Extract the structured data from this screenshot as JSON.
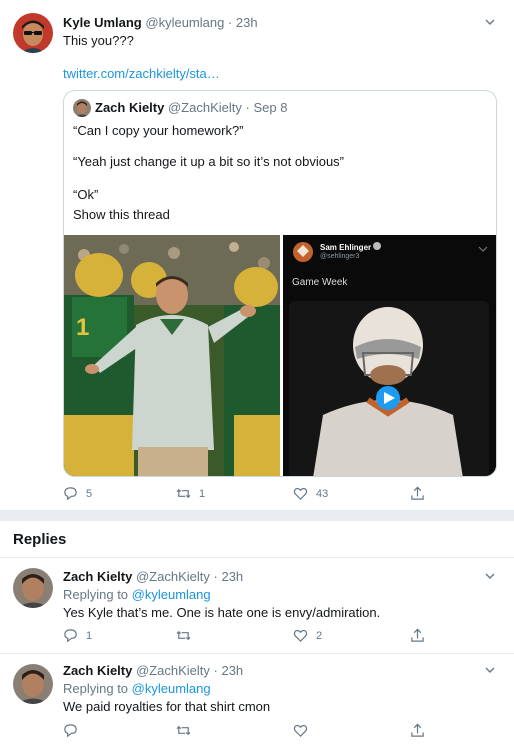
{
  "main_tweet": {
    "name": "Kyle Umlang",
    "handle": "@kyleumlang",
    "dot": "·",
    "time": "23h",
    "text": "This you???",
    "link": "twitter.com/zachkielty/sta…",
    "quote": {
      "name": "Zach Kielty",
      "handle": "@ZachKielty",
      "dot": "·",
      "date": "Sep 8",
      "line1": "“Can I copy your homework?”",
      "line2": "“Yeah just change it up a bit so it’s not obvious”",
      "line3": "“Ok”",
      "show_thread": "Show this thread",
      "embedded": {
        "name": "Sam Ehlinger",
        "handle": "@sehlinger3",
        "text": "Game Week"
      }
    },
    "actions": {
      "replies": "5",
      "retweets": "1",
      "likes": "43"
    }
  },
  "replies_title": "Replies",
  "replies": [
    {
      "name": "Zach Kielty",
      "handle": "@ZachKielty",
      "dot": "·",
      "time": "23h",
      "replying_prefix": "Replying to",
      "replying_to": "@kyleumlang",
      "text": "Yes Kyle that’s me. One is hate one is envy/admiration.",
      "actions": {
        "replies": "1",
        "retweets": "",
        "likes": "2"
      }
    },
    {
      "name": "Zach Kielty",
      "handle": "@ZachKielty",
      "dot": "·",
      "time": "23h",
      "replying_prefix": "Replying to",
      "replying_to": "@kyleumlang",
      "text": "We paid royalties for that shirt cmon",
      "actions": {
        "replies": "",
        "retweets": "",
        "likes": ""
      }
    }
  ],
  "colors": {
    "link": "#1b95e0",
    "muted": "#657786",
    "border": "#e6ecf0"
  }
}
